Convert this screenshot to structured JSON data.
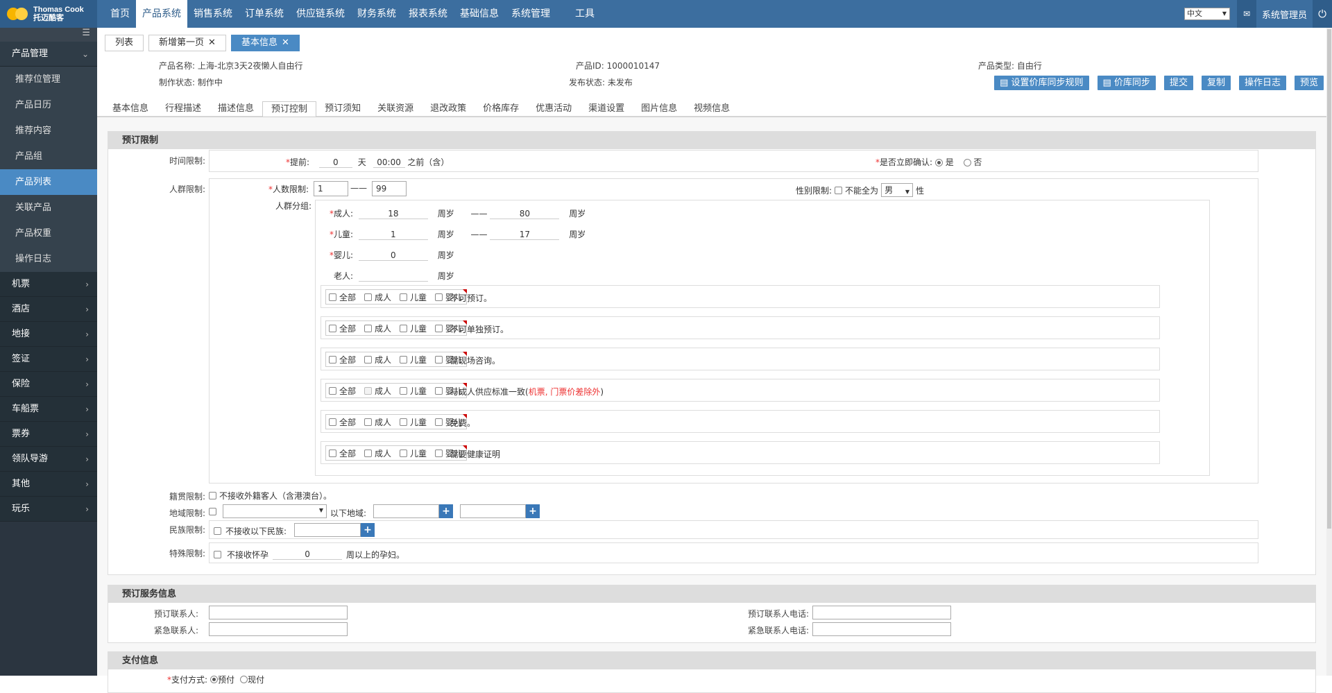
{
  "brand": {
    "name": "Thomas Cook",
    "name_cn": "托迈酷客"
  },
  "nav": [
    "首页",
    "产品系统",
    "销售系统",
    "订单系统",
    "供应链系统",
    "财务系统",
    "报表系统",
    "基础信息",
    "系统管理",
    "工具"
  ],
  "topright": {
    "lang": "中文",
    "user": "系统管理员"
  },
  "sidebar": {
    "group_open": "产品管理",
    "items": [
      "推荐位管理",
      "产品日历",
      "推荐内容",
      "产品组",
      "产品列表",
      "关联产品",
      "产品权重",
      "操作日志"
    ],
    "groups": [
      "机票",
      "酒店",
      "地接",
      "签证",
      "保险",
      "车船票",
      "票券",
      "领队导游",
      "其他",
      "玩乐"
    ]
  },
  "tabs": [
    "列表",
    "新增第一页",
    "基本信息"
  ],
  "info": {
    "name_label": "产品名称:",
    "name": "上海-北京3天2夜懒人自由行",
    "id_label": "产品ID:",
    "id": "1000010147",
    "type_label": "产品类型:",
    "type": "自由行",
    "status_label": "制作状态:",
    "status": "制作中",
    "pub_label": "发布状态:",
    "pub": "未发布"
  },
  "buttons": [
    "设置价库同步规则",
    "价库同步",
    "提交",
    "复制",
    "操作日志",
    "预览"
  ],
  "subtabs": [
    "基本信息",
    "行程描述",
    "描述信息",
    "预订控制",
    "预订须知",
    "关联资源",
    "退改政策",
    "价格库存",
    "优惠活动",
    "渠道设置",
    "图片信息",
    "视频信息"
  ],
  "booking": {
    "title": "预订限制",
    "time_label": "时间限制:",
    "advance_label": "提前:",
    "advance_days": "0",
    "day_unit": "天",
    "advance_time": "00:00",
    "before": "之前（含）",
    "confirm_label": "是否立即确认:",
    "yes": "是",
    "no": "否",
    "crowd_label": "人群限制:",
    "count_label": "人数限制:",
    "count_min": "1",
    "count_max": "99",
    "dash": "——",
    "gender_label": "性别限制:",
    "gender_text": "不能全为",
    "gender_value": "男",
    "gender_suffix": "性",
    "group_label": "人群分组:",
    "adult_label": "成人:",
    "adult_min": "18",
    "adult_max": "80",
    "child_label": "儿童:",
    "child_min": "1",
    "child_max": "17",
    "infant_label": "婴儿:",
    "infant_min": "0",
    "senior_label": "老人:",
    "senior_min": "",
    "age_unit": "周岁",
    "chk": [
      "全部",
      "成人",
      "儿童",
      "婴儿"
    ],
    "rows": [
      "不可预订。",
      "不可单独预订。",
      "需现场咨询。",
      "与成人供应标准一致(",
      "免费。",
      "需要健康证明"
    ],
    "row4_red": "机票, 门票价差除外",
    "row4_end": ")",
    "native_label": "籍贯限制:",
    "native_text": "不接收外籍客人（含港澳台）。",
    "region_label": "地域限制:",
    "region_text": "以下地域:",
    "ethnic_label": "民族限制:",
    "ethnic_text": "不接收以下民族:",
    "special_label": "特殊限制:",
    "special_text": "不接收怀孕",
    "special_weeks": "0",
    "special_suffix": "周以上的孕妇。"
  },
  "service": {
    "title": "预订服务信息",
    "contact": "预订联系人:",
    "contact_phone": "预订联系人电话:",
    "emergency": "紧急联系人:",
    "emergency_phone": "紧急联系人电话:"
  },
  "payment": {
    "title": "支付信息",
    "method_label": "支付方式:",
    "opt1": "预付",
    "opt2": "现付"
  },
  "colors": {
    "topbar": "#3c6e9f",
    "accent": "#4a8ac4",
    "sidebar": "#2b3540"
  }
}
